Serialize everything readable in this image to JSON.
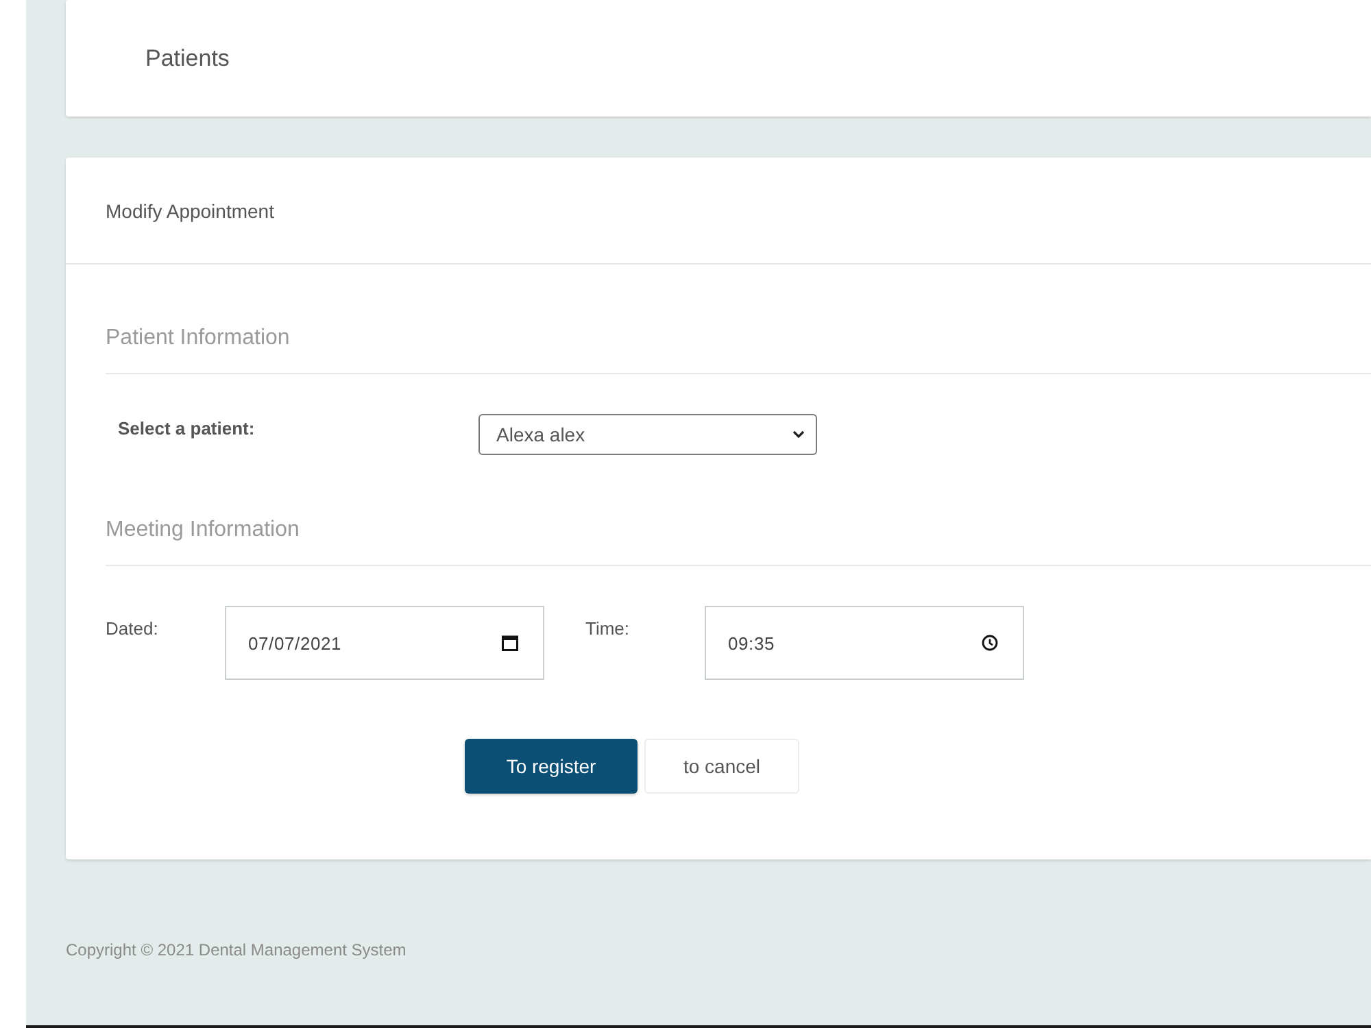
{
  "page_header": {
    "title": "Patients"
  },
  "card": {
    "title": "Modify Appointment",
    "patient_section": {
      "heading": "Patient Information",
      "patient_select": {
        "label": "Select a patient:",
        "value": "Alexa alex"
      }
    },
    "meeting_section": {
      "heading": "Meeting Information",
      "fields": [
        {
          "kind": "date",
          "label": "Dated:",
          "value": "07/07/2021"
        },
        {
          "kind": "time",
          "label": "Time:",
          "value": "09:35"
        }
      ]
    },
    "buttons": [
      {
        "kind": "primary",
        "label": "To register"
      },
      {
        "kind": "secondary",
        "label": "to cancel"
      }
    ]
  },
  "footer": {
    "text": "Copyright © 2021 Dental Management System"
  }
}
